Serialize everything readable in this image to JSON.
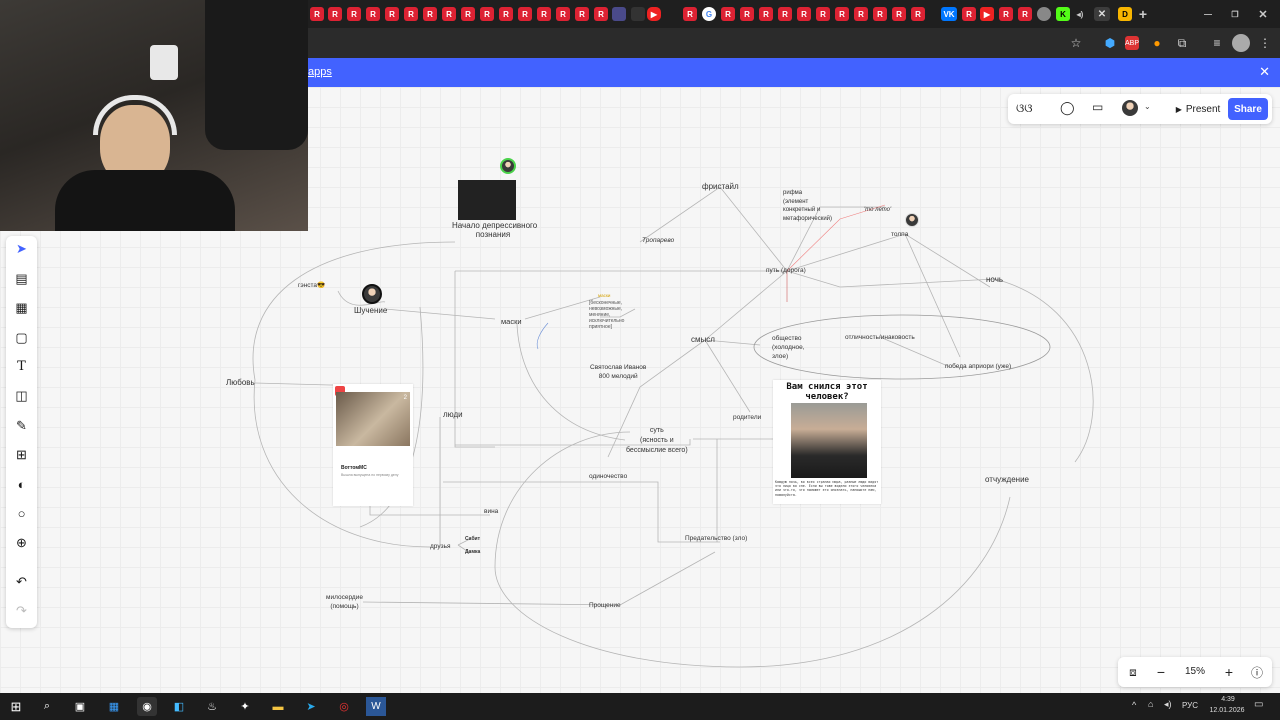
{
  "banner": {
    "text": "apps",
    "close": "✕"
  },
  "collab": {
    "present_label": "Present",
    "share_label": "Share"
  },
  "zoom": {
    "level": "15%"
  },
  "board": {
    "labels": {
      "freestyle": "фристайл",
      "rhyme": "рифма\n(элемент\nконкретный и\nметафорический)",
      "that_summer": "'то лето'",
      "crowd": "толпа",
      "tropparevo": "Тропарево",
      "path": "путь (дорога)",
      "night": "ночь",
      "gangsta": "гэнста😎",
      "jokes": "Шучение",
      "masks": "маски",
      "masks_note": "[бесконечные,\nневозможные,\nменяние,\nисключительно\nприятное]",
      "masks_note_title": "маски",
      "meaning": "смысл",
      "society": "общество\n(холодное,\nзлое)",
      "otherness": "отличность/инаковость",
      "victory": "победа априори (уже)",
      "love": "Любовь",
      "people": "люди",
      "sviatoslav": "Святослав Иванов\n800 мелодий",
      "parents": "родители",
      "essence": "суть\n(ясность и\nбессмыслие всего)",
      "loneliness": "одиночество",
      "guilt": "вина",
      "friends": "друзья",
      "friend1": "Сабит",
      "friend2": "Дамка",
      "betrayal": "Предательство (зло)",
      "mercy": "милосердие\n(помощь)",
      "forgiveness": "Прощение",
      "alienation": "отчуждение",
      "depressive": "Начало депрессивного\nпознания",
      "dream_title": "Вам снился этот\nчеловек?",
      "dream_text": "Каждую ночь, во всех странах мира, разные люди видят это лицо во сне. Если вы тоже видели этого человека или что-то, что поможет его опознать, напишите нам, пожалуйста.",
      "card_name": "ВоттомМС",
      "card_sub": "Вышла выпущена по первому делу",
      "card_badge": "2"
    }
  },
  "taskbar": {
    "lang": "РУС",
    "time": "4:39",
    "date": "12.01.2026"
  },
  "colors": {
    "accent": "#4262ff",
    "banner": "#4262ff",
    "canvas": "#f6f6f6"
  }
}
